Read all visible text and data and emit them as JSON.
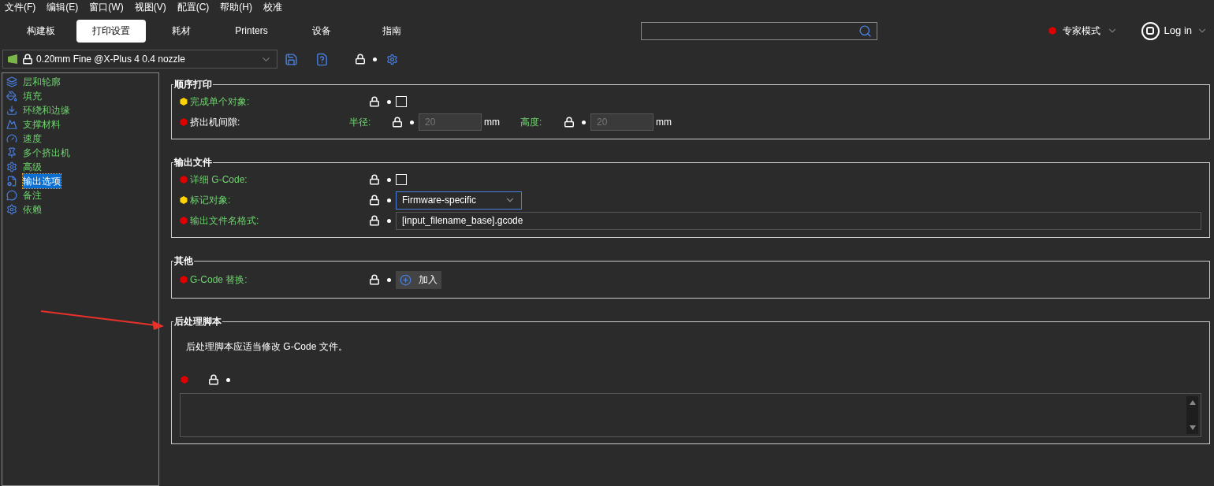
{
  "menu": [
    {
      "label": "文件(F)"
    },
    {
      "label": "编辑(E)"
    },
    {
      "label": "窗口(W)"
    },
    {
      "label": "视图(V)"
    },
    {
      "label": "配置(C)"
    },
    {
      "label": "帮助(H)"
    },
    {
      "label": "校准"
    }
  ],
  "tabs": [
    {
      "label": "构建板",
      "selected": false
    },
    {
      "label": "打印设置",
      "selected": true
    },
    {
      "label": "耗材",
      "selected": false
    },
    {
      "label": "Printers",
      "selected": false
    },
    {
      "label": "设备",
      "selected": false
    },
    {
      "label": "指南",
      "selected": false
    }
  ],
  "mode": {
    "label": "专家模式",
    "color": "#e00000"
  },
  "login": {
    "label": "Log in"
  },
  "preset": {
    "name": "0.20mm Fine @X-Plus 4 0.4 nozzle"
  },
  "sidebar": {
    "items": [
      {
        "label": "层和轮廓",
        "selected": false
      },
      {
        "label": "填充",
        "selected": false
      },
      {
        "label": "环绕和边缘",
        "selected": false
      },
      {
        "label": "支撑材料",
        "selected": false
      },
      {
        "label": "速度",
        "selected": false
      },
      {
        "label": "多个挤出机",
        "selected": false
      },
      {
        "label": "高级",
        "selected": false
      },
      {
        "label": "输出选项",
        "selected": true
      },
      {
        "label": "备注",
        "selected": false
      },
      {
        "label": "依赖",
        "selected": false
      }
    ]
  },
  "sections": [
    {
      "title": "顺序打印",
      "rows": [
        {
          "kind": "checkbox",
          "label": "完成单个对象:",
          "color": "#ffd400",
          "system_value": true,
          "checked": false
        },
        {
          "kind": "pair",
          "label": "挤出机间隙:",
          "color": "#e00000",
          "system_value": false,
          "fields": [
            {
              "label": "半径:",
              "value": "20",
              "unit": "mm",
              "disabled": true
            },
            {
              "label": "高度:",
              "value": "20",
              "unit": "mm",
              "disabled": true
            }
          ]
        }
      ]
    },
    {
      "title": "输出文件",
      "rows": [
        {
          "kind": "checkbox",
          "label": "详细 G-Code:",
          "color": "#e00000",
          "system_value": true,
          "checked": false
        },
        {
          "kind": "select",
          "label": "标记对象:",
          "color": "#ffd400",
          "system_value": true,
          "value": "Firmware-specific"
        },
        {
          "kind": "text",
          "label": "输出文件名格式:",
          "color": "#e00000",
          "system_value": true,
          "value": "[input_filename_base].gcode"
        }
      ]
    },
    {
      "title": "其他",
      "rows": [
        {
          "kind": "button",
          "label": "G-Code 替换:",
          "color": "#e00000",
          "system_value": true,
          "button": "加入"
        }
      ]
    },
    {
      "title": "后处理脚本",
      "note": "后处理脚本应适当修改 G-Code 文件。",
      "rows": [
        {
          "kind": "textarea",
          "color": "#e00000"
        }
      ]
    }
  ]
}
